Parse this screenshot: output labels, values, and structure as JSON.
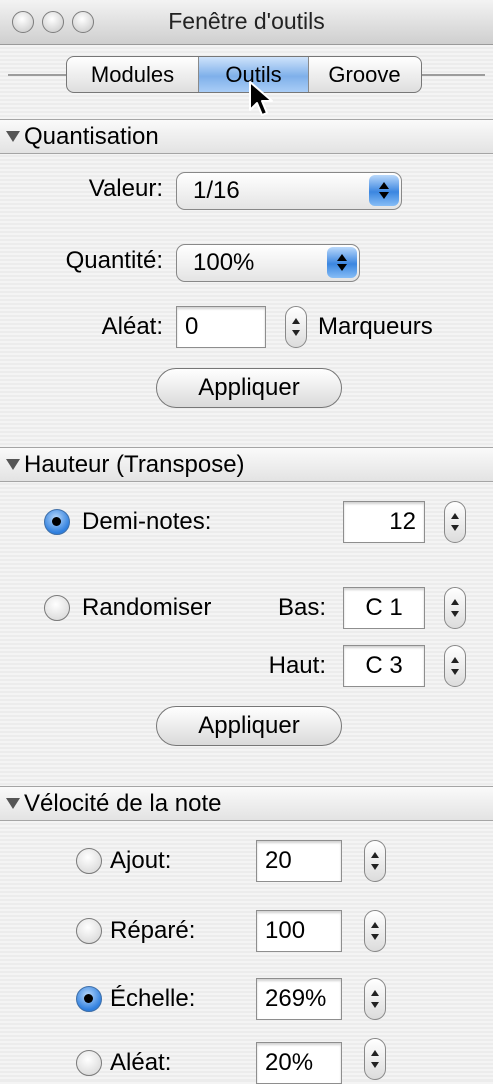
{
  "window": {
    "title": "Fenêtre d'outils"
  },
  "tabs": [
    {
      "label": "Modules",
      "active": false
    },
    {
      "label": "Outils",
      "active": true
    },
    {
      "label": "Groove",
      "active": false
    }
  ],
  "quantisation": {
    "header": "Quantisation",
    "valeur_label": "Valeur:",
    "valeur_value": "1/16",
    "quantite_label": "Quantité:",
    "quantite_value": "100%",
    "aleat_label": "Aléat:",
    "aleat_value": "0",
    "aleat_unit": "Marqueurs",
    "apply_label": "Appliquer"
  },
  "hauteur": {
    "header": "Hauteur (Transpose)",
    "demi_notes_label": "Demi-notes:",
    "demi_notes_value": "12",
    "randomiser_label": "Randomiser",
    "bas_label": "Bas:",
    "bas_value": "C 1",
    "haut_label": "Haut:",
    "haut_value": "C 3",
    "apply_label": "Appliquer",
    "selected": "demi_notes"
  },
  "velocite": {
    "header": "Vélocité de la note",
    "ajout_label": "Ajout:",
    "ajout_value": "20",
    "repare_label": "Réparé:",
    "repare_value": "100",
    "echelle_label": "Échelle:",
    "echelle_value": "269%",
    "aleat_label": "Aléat:",
    "aleat_value": "20%",
    "selected": "echelle"
  },
  "colors": {
    "accent_blue": "#3b86e0",
    "tab_active": "#7fb0ea"
  }
}
